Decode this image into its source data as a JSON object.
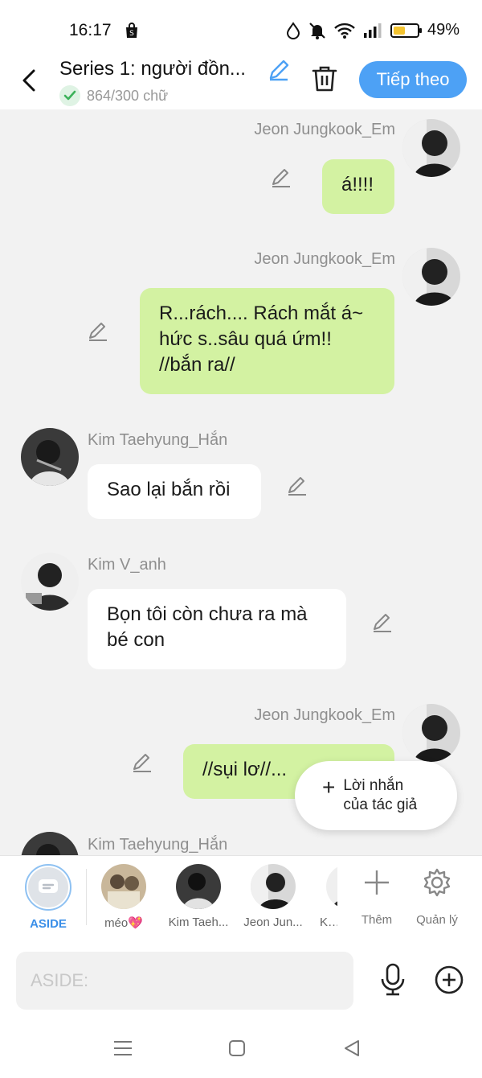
{
  "status_bar": {
    "time": "16:17",
    "battery": "49%",
    "battery_level": 0.49
  },
  "header": {
    "title": "Series 1: người đồn...",
    "word_count": "864/300 chữ",
    "next_label": "Tiếp theo"
  },
  "messages": [
    {
      "sender": "Jeon Jungkook_Em",
      "side": "right",
      "text": "á!!!!"
    },
    {
      "sender": "Jeon Jungkook_Em",
      "side": "right",
      "text": "R...rách.... Rách mắt á~ hức s..sâu quá ứm!! //bắn ra//"
    },
    {
      "sender": "Kim Taehyung_Hắn",
      "side": "left",
      "text": "Sao lại bắn rồi"
    },
    {
      "sender": "Kim V_anh",
      "side": "left",
      "text": "Bọn tôi còn chưa ra mà bé con"
    },
    {
      "sender": "Jeon Jungkook_Em",
      "side": "right",
      "text": "//sụi lơ//..."
    },
    {
      "sender": "Kim Taehyung_Hắn",
      "side": "left",
      "text": ""
    }
  ],
  "author_note": {
    "label": "Lời nhắn của tác giả"
  },
  "characters": [
    {
      "label": "ASIDE"
    },
    {
      "label": "méo💖"
    },
    {
      "label": "Kim Taeh..."
    },
    {
      "label": "Jeon Jun..."
    },
    {
      "label": "Kim"
    }
  ],
  "tools": {
    "add_label": "Thêm",
    "manage_label": "Quản lý"
  },
  "input": {
    "placeholder": "ASIDE:"
  },
  "colors": {
    "accent": "#4da1f5",
    "bubble_right": "#d3f2a2",
    "bubble_left": "#ffffff",
    "background": "#f2f2f2"
  },
  "icons": [
    "back-arrow-icon",
    "pencil-icon",
    "trash-icon",
    "check-icon",
    "plus-icon",
    "gear-icon",
    "microphone-icon",
    "add-circle-icon",
    "menu-icon",
    "home-square-icon",
    "back-triangle-icon"
  ]
}
